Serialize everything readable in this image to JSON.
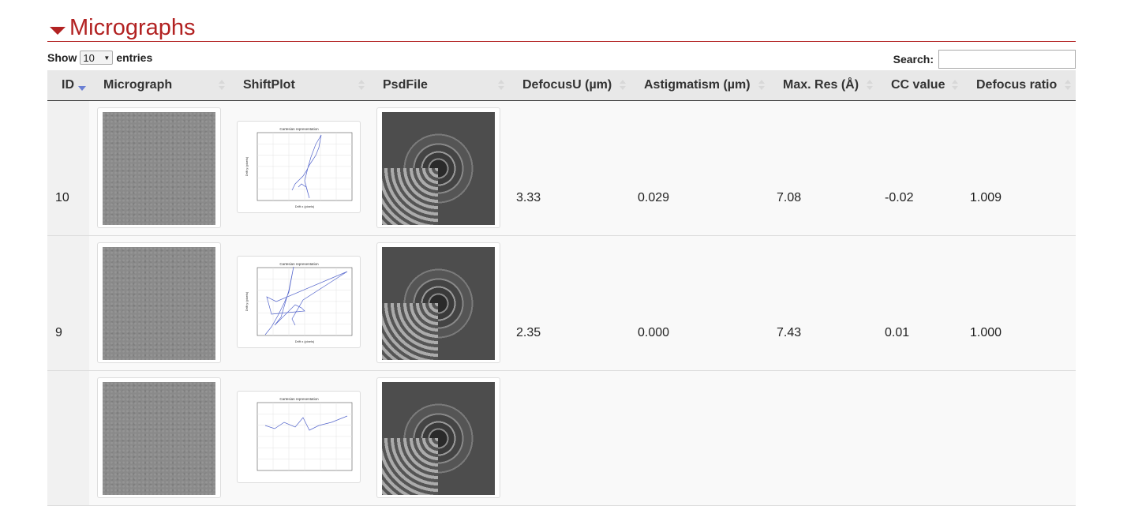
{
  "section": {
    "title": "Micrographs",
    "accent": "#b22222"
  },
  "controls": {
    "show_label": "Show",
    "entries_value": "10",
    "entries_label": "entries",
    "search_label": "Search:",
    "search_value": ""
  },
  "table": {
    "columns": [
      "ID",
      "Micrograph",
      "ShiftPlot",
      "PsdFile",
      "DefocusU (µm)",
      "Astigmatism (µm)",
      "Max. Res (Å)",
      "CC value",
      "Defocus ratio"
    ],
    "rows": [
      {
        "id": "10",
        "defocus_u": "3.33",
        "astigmatism": "0.029",
        "max_res": "7.08",
        "cc_value": "-0.02",
        "defocus_ratio": "1.009",
        "plot_title": "Cartesian representation",
        "plot_xlabel": "Drift x (pixels)",
        "plot_ylabel": "Drift y (pixels)"
      },
      {
        "id": "9",
        "defocus_u": "2.35",
        "astigmatism": "0.000",
        "max_res": "7.43",
        "cc_value": "0.01",
        "defocus_ratio": "1.000",
        "plot_title": "Cartesian representation",
        "plot_xlabel": "Drift x (pixels)",
        "plot_ylabel": "Drift y (pixels)"
      },
      {
        "id": "",
        "defocus_u": "",
        "astigmatism": "",
        "max_res": "",
        "cc_value": "",
        "defocus_ratio": "",
        "plot_title": "Cartesian representation",
        "plot_xlabel": "",
        "plot_ylabel": ""
      }
    ]
  },
  "colors": {
    "sort_active": "#6a7fd4",
    "header_bg": "#e8e8e8"
  }
}
